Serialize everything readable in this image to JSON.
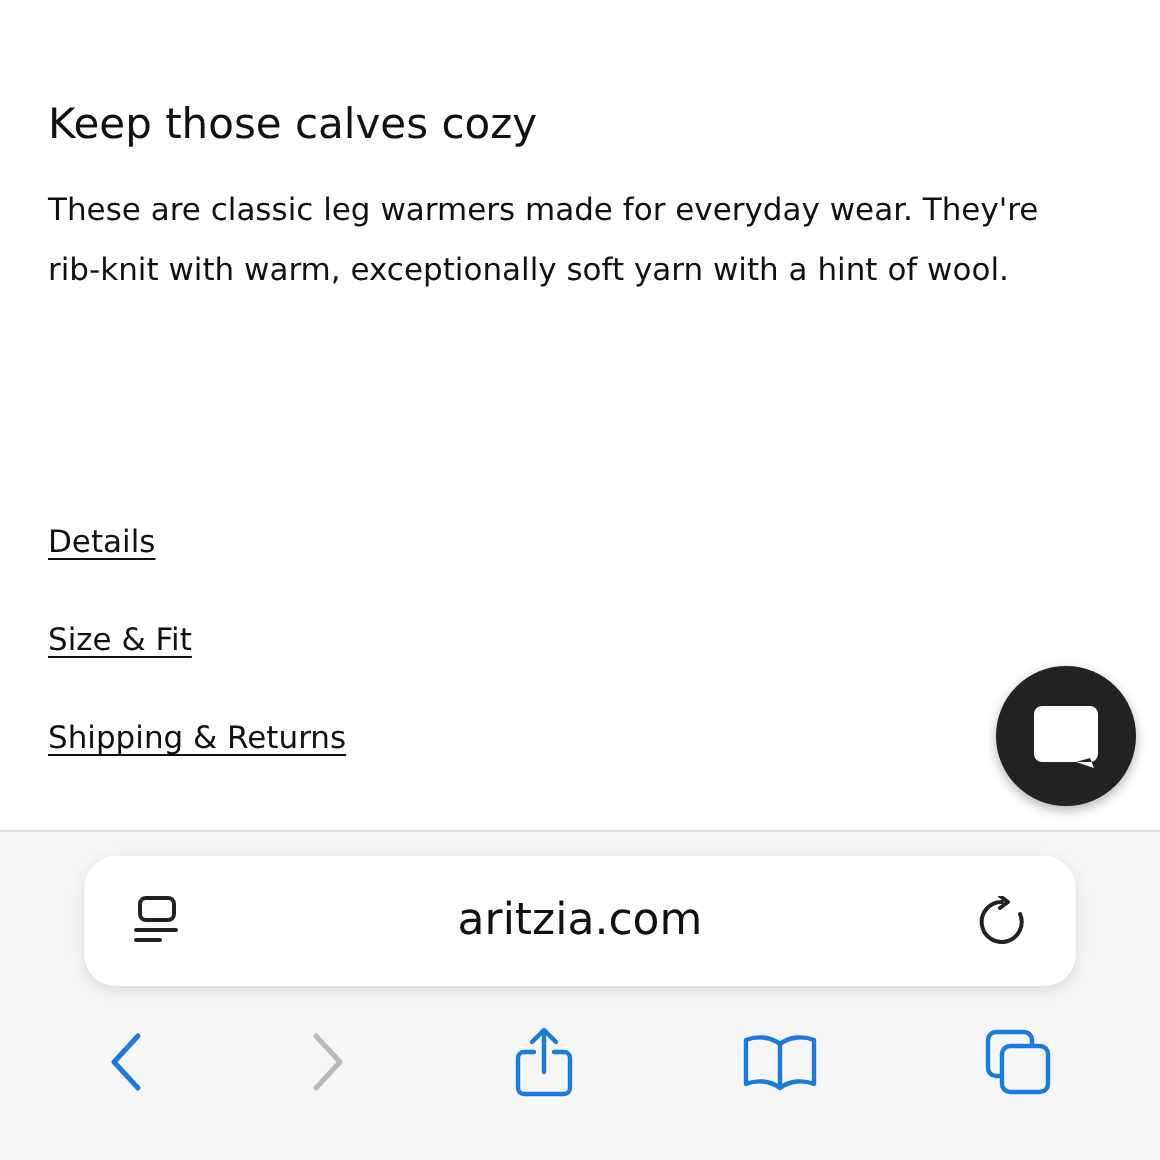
{
  "product": {
    "heading": "Keep those calves cozy",
    "description": "These are classic leg warmers made for everyday wear. They're rib-knit with warm, exceptionally soft yarn with a hint of wool."
  },
  "links": [
    "Details",
    "Size & Fit",
    "Shipping & Returns"
  ],
  "address_bar": {
    "url": "aritzia.com"
  },
  "toolbar": [
    {
      "kind": "back",
      "disabled": false
    },
    {
      "kind": "forward",
      "disabled": true
    },
    {
      "kind": "share",
      "disabled": false
    },
    {
      "kind": "bookmarks",
      "disabled": false
    },
    {
      "kind": "tabs",
      "disabled": false
    }
  ]
}
